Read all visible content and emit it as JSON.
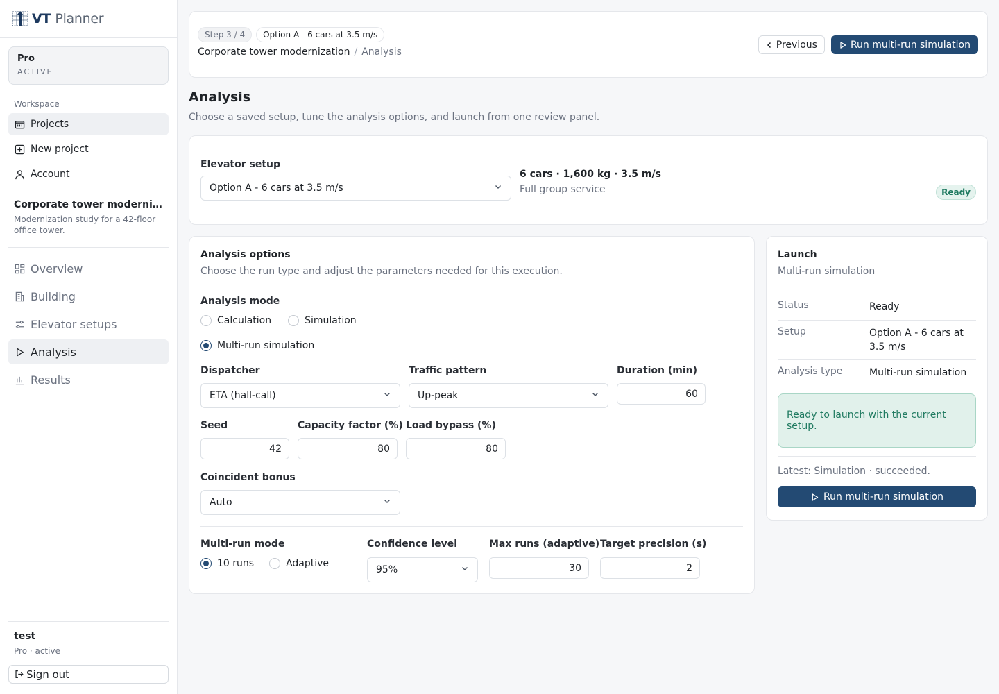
{
  "app": {
    "logo_bold": "VT",
    "logo_light": "Planner"
  },
  "plan": {
    "name": "Pro",
    "status": "ACTIVE"
  },
  "sidebar": {
    "workspace_label": "Workspace",
    "workspace_items": [
      {
        "label": "Projects",
        "icon": "folder-icon",
        "active": true
      },
      {
        "label": "New project",
        "icon": "plus-square-icon"
      },
      {
        "label": "Account",
        "icon": "user-icon"
      }
    ],
    "project": {
      "title": "Corporate tower modernizati...",
      "description": "Modernization study for a 42-floor office tower."
    },
    "section_items": [
      {
        "label": "Overview",
        "icon": "grid-icon"
      },
      {
        "label": "Building",
        "icon": "building-icon"
      },
      {
        "label": "Elevator setups",
        "icon": "sliders-icon"
      },
      {
        "label": "Analysis",
        "icon": "play-icon",
        "active": true
      },
      {
        "label": "Results",
        "icon": "bar-chart-icon"
      }
    ],
    "user": {
      "name": "test",
      "plan": "Pro · active",
      "signout": "Sign out"
    }
  },
  "header": {
    "step_chip": "Step 3 / 4",
    "setup_chip": "Option A - 6 cars at 3.5 m/s",
    "breadcrumb_project": "Corporate tower modernization",
    "breadcrumb_sep": "/",
    "breadcrumb_page": "Analysis",
    "previous_label": "Previous",
    "run_label": "Run multi-run simulation"
  },
  "page": {
    "title": "Analysis",
    "subtitle": "Choose a saved setup, tune the analysis options, and launch from one review panel."
  },
  "setup": {
    "label": "Elevator setup",
    "selected": "Option A - 6 cars at 3.5 m/s",
    "spec": "6 cars · 1,600 kg · 3.5 m/s",
    "service": "Full group service",
    "badge": "Ready"
  },
  "options": {
    "title": "Analysis options",
    "subtitle": "Choose the run type and adjust the parameters needed for this execution.",
    "mode_label": "Analysis mode",
    "modes": [
      {
        "label": "Calculation",
        "checked": false
      },
      {
        "label": "Simulation",
        "checked": false
      },
      {
        "label": "Multi-run simulation",
        "checked": true
      }
    ],
    "dispatcher_label": "Dispatcher",
    "dispatcher_value": "ETA (hall-call)",
    "traffic_label": "Traffic pattern",
    "traffic_value": "Up-peak",
    "duration_label": "Duration (min)",
    "duration_value": "60",
    "seed_label": "Seed",
    "seed_value": "42",
    "capacity_label": "Capacity factor (%)",
    "capacity_value": "80",
    "bypass_label": "Load bypass (%)",
    "bypass_value": "80",
    "coincident_label": "Coincident bonus",
    "coincident_value": "Auto",
    "multirun_label": "Multi-run mode",
    "multirun_modes": [
      {
        "label": "10 runs",
        "checked": true
      },
      {
        "label": "Adaptive",
        "checked": false
      }
    ],
    "confidence_label": "Confidence level",
    "confidence_value": "95%",
    "maxruns_label": "Max runs (adaptive)",
    "maxruns_value": "30",
    "precision_label": "Target precision (s)",
    "precision_value": "2"
  },
  "launch": {
    "title": "Launch",
    "subtitle": "Multi-run simulation",
    "rows": [
      {
        "key": "Status",
        "value": "Ready"
      },
      {
        "key": "Setup",
        "value": "Option A - 6 cars at 3.5 m/s"
      },
      {
        "key": "Analysis type",
        "value": "Multi-run simulation"
      }
    ],
    "notice": "Ready to launch with the current setup.",
    "latest": "Latest: Simulation · succeeded.",
    "button": "Run multi-run simulation"
  },
  "colors": {
    "primary": "#234a73",
    "success": "#1f7a60",
    "success_bg": "#e1f1eb"
  }
}
